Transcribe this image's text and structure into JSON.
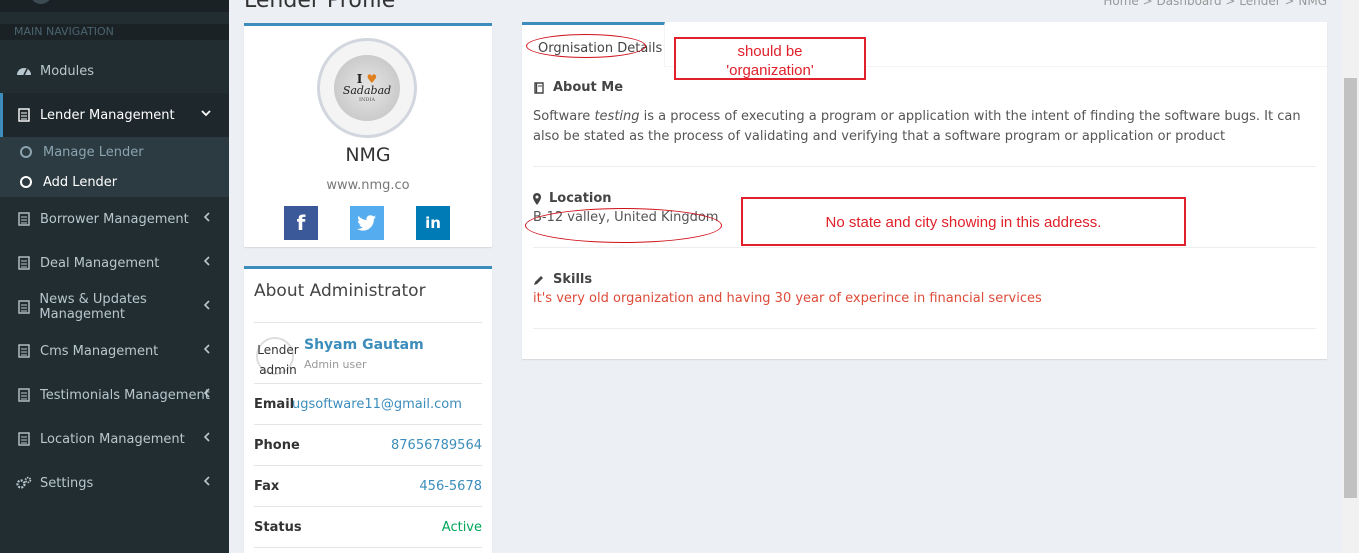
{
  "sidebar": {
    "header": "MAIN NAVIGATION",
    "items": [
      {
        "label": "Modules",
        "icon": "dashboard-icon"
      },
      {
        "label": "Lender Management",
        "icon": "list-icon"
      },
      {
        "label": "Borrower Management",
        "icon": "list-icon"
      },
      {
        "label": "Deal Management",
        "icon": "list-icon"
      },
      {
        "label": "News & Updates Management",
        "icon": "list-icon"
      },
      {
        "label": "Cms Management",
        "icon": "list-icon"
      },
      {
        "label": "Testimonials Management",
        "icon": "list-icon"
      },
      {
        "label": "Location Management",
        "icon": "list-icon"
      },
      {
        "label": "Settings",
        "icon": "gears-icon"
      }
    ],
    "submenu": [
      "Manage Lender",
      "Add Lender"
    ]
  },
  "page": {
    "title": "Lender Profile",
    "breadcrumb": "Home  >  Dashboard  >  Lender  >  NMG"
  },
  "profile": {
    "logo_line1": "I",
    "logo_line2": "Sadabad",
    "logo_line3": "INDIA",
    "name": "NMG",
    "website": "www.nmg.co",
    "social": {
      "facebook": "f",
      "twitter": "t",
      "linkedin": "in"
    }
  },
  "admin": {
    "title": "About Administrator",
    "avatar_text": "Lender admin",
    "name": "Shyam Gautam",
    "role": "Admin user",
    "email_label": "Email",
    "email": "ugsoftware11@gmail.com",
    "phone_label": "Phone",
    "phone": "87656789564",
    "fax_label": "Fax",
    "fax": "456-5678",
    "status_label": "Status",
    "status": "Active"
  },
  "details": {
    "tab": "Orgnisation Details",
    "about_title": "About Me",
    "about_prefix": "Software ",
    "about_em": "testing",
    "about_rest": " is a process of executing a program or application with the intent of finding the software bugs. It can also be stated as the process of validating and verifying that a software program or application or product",
    "location_title": "Location",
    "location": "B-12 valley, United Kingdom",
    "skills_title": "Skills",
    "skills": "it's very old organization and having 30 year of experince in financial services"
  },
  "annotations": {
    "note1_line1": "should be",
    "note1_line2": "'organization'",
    "note2": "No state and city showing in this address."
  },
  "colors": {
    "sidebar_bg": "#222d32",
    "accent": "#3c8dbc",
    "annotation_red": "#e0202a",
    "status_green": "#00a65a"
  }
}
